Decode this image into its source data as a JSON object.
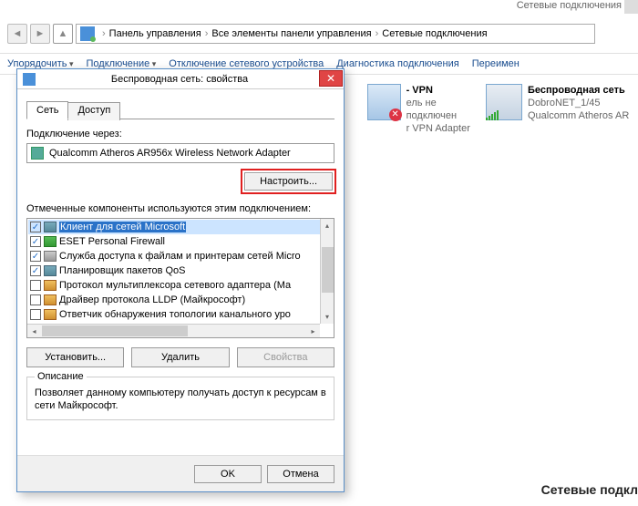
{
  "topbar_hint": "Сетевые подключения",
  "breadcrumb": {
    "items": [
      "Панель управления",
      "Все элементы панели управления",
      "Сетевые подключения"
    ]
  },
  "toolbar": {
    "organize": "Упорядочить",
    "connect": "Подключение",
    "disable": "Отключение сетевого устройства",
    "diagnose": "Диагностика подключения",
    "rename": "Переимен"
  },
  "dialog": {
    "title": "Беспроводная сеть: свойства",
    "tab_network": "Сеть",
    "tab_access": "Доступ",
    "connect_via": "Подключение через:",
    "adapter": "Qualcomm Atheros AR956x Wireless Network Adapter",
    "configure": "Настроить...",
    "components_label": "Отмеченные компоненты используются этим подключением:",
    "components": [
      {
        "checked": true,
        "icon": "monitor",
        "label": "Клиент для сетей Microsoft",
        "selected": true
      },
      {
        "checked": true,
        "icon": "shield",
        "label": "ESET Personal Firewall"
      },
      {
        "checked": true,
        "icon": "printer",
        "label": "Служба доступа к файлам и принтерам сетей Micro"
      },
      {
        "checked": true,
        "icon": "monitor",
        "label": "Планировщик пакетов QoS"
      },
      {
        "checked": false,
        "icon": "net",
        "label": "Протокол мультиплексора сетевого адаптера (Ма"
      },
      {
        "checked": false,
        "icon": "net",
        "label": "Драйвер протокола LLDP (Майкрософт)"
      },
      {
        "checked": false,
        "icon": "net",
        "label": "Ответчик обнаружения топологии канального уро"
      }
    ],
    "install": "Установить...",
    "uninstall": "Удалить",
    "properties": "Свойства",
    "desc_legend": "Описание",
    "desc_text": "Позволяет данному компьютеру получать доступ к ресурсам в сети Майкрософт.",
    "ok": "OK",
    "cancel": "Отмена"
  },
  "connections": {
    "vpn": {
      "name": "- VPN",
      "status": "ель не подключен",
      "device": "r VPN Adapter"
    },
    "wifi": {
      "name": "Беспроводная сеть",
      "ssid": "DobroNET_1/45",
      "device": "Qualcomm Atheros AR"
    }
  },
  "bottom_label": "Сетевые подкл"
}
